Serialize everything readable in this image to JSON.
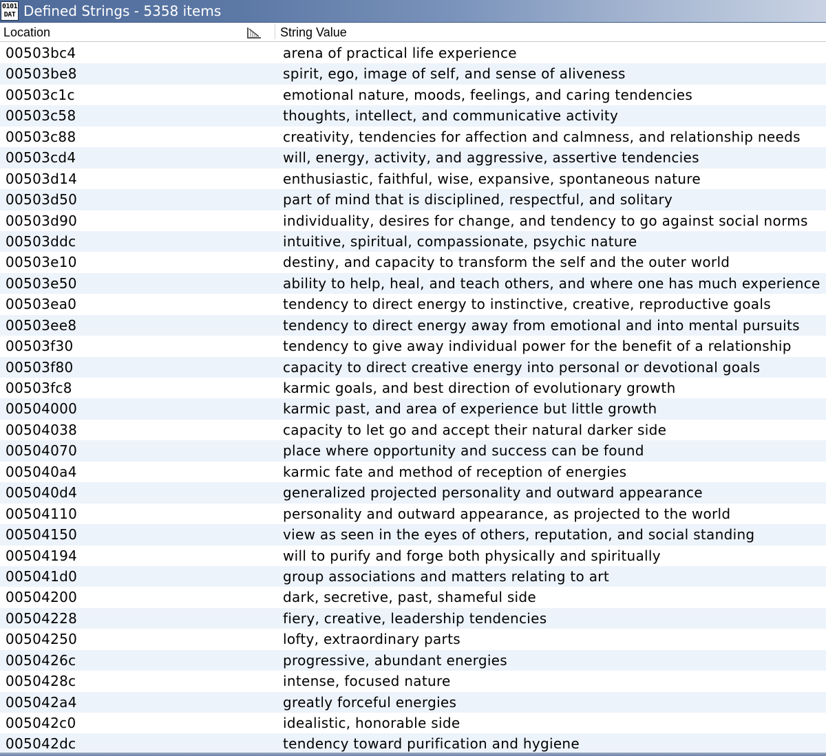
{
  "window": {
    "title": "Defined Strings - 5358 items",
    "icon_line1": "0101",
    "icon_line2": "DAT",
    "icon_name": "data-type-icon"
  },
  "table": {
    "columns": [
      {
        "label": "Location"
      },
      {
        "label": "String Value"
      }
    ],
    "sort_icon": "sort-column-icon",
    "rows": [
      {
        "location": "00503bc4",
        "value": "arena of practical life experience"
      },
      {
        "location": "00503be8",
        "value": "spirit, ego, image of self, and sense of aliveness"
      },
      {
        "location": "00503c1c",
        "value": "emotional nature, moods, feelings, and caring tendencies"
      },
      {
        "location": "00503c58",
        "value": "thoughts, intellect, and communicative activity"
      },
      {
        "location": "00503c88",
        "value": "creativity, tendencies for affection and calmness, and relationship needs"
      },
      {
        "location": "00503cd4",
        "value": "will, energy, activity, and aggressive, assertive tendencies"
      },
      {
        "location": "00503d14",
        "value": "enthusiastic, faithful, wise, expansive, spontaneous nature"
      },
      {
        "location": "00503d50",
        "value": "part of mind that is disciplined, respectful, and solitary"
      },
      {
        "location": "00503d90",
        "value": "individuality, desires for change, and tendency to go against social norms"
      },
      {
        "location": "00503ddc",
        "value": "intuitive, spiritual, compassionate, psychic nature"
      },
      {
        "location": "00503e10",
        "value": "destiny, and capacity to transform the self and the outer world"
      },
      {
        "location": "00503e50",
        "value": "ability to help, heal, and teach others, and where one has much experience"
      },
      {
        "location": "00503ea0",
        "value": "tendency to direct energy to instinctive, creative, reproductive goals"
      },
      {
        "location": "00503ee8",
        "value": "tendency to direct energy away from emotional and into mental pursuits"
      },
      {
        "location": "00503f30",
        "value": "tendency to give away individual power for the benefit of a relationship"
      },
      {
        "location": "00503f80",
        "value": "capacity to direct creative energy into personal or devotional goals"
      },
      {
        "location": "00503fc8",
        "value": "karmic goals, and best direction of evolutionary growth"
      },
      {
        "location": "00504000",
        "value": "karmic past, and area of experience but little growth"
      },
      {
        "location": "00504038",
        "value": "capacity to let go and accept their natural darker side"
      },
      {
        "location": "00504070",
        "value": "place where opportunity and success can be found"
      },
      {
        "location": "005040a4",
        "value": "karmic fate and method of reception of energies"
      },
      {
        "location": "005040d4",
        "value": "generalized projected personality and outward appearance"
      },
      {
        "location": "00504110",
        "value": "personality and outward appearance, as projected to the world"
      },
      {
        "location": "00504150",
        "value": "view as seen in the eyes of others, reputation, and social standing"
      },
      {
        "location": "00504194",
        "value": "will to purify and forge both physically and spiritually"
      },
      {
        "location": "005041d0",
        "value": "group associations and matters relating to art"
      },
      {
        "location": "00504200",
        "value": "dark, secretive, past, shameful side"
      },
      {
        "location": "00504228",
        "value": "fiery, creative, leadership tendencies"
      },
      {
        "location": "00504250",
        "value": "lofty, extraordinary parts"
      },
      {
        "location": "0050426c",
        "value": "progressive, abundant energies"
      },
      {
        "location": "0050428c",
        "value": "intense, focused nature"
      },
      {
        "location": "005042a4",
        "value": "greatly forceful energies"
      },
      {
        "location": "005042c0",
        "value": "idealistic, honorable side"
      },
      {
        "location": "005042dc",
        "value": "tendency toward purification and hygiene"
      }
    ]
  },
  "colors": {
    "title_bar_start": "#4d6a99",
    "title_bar_end": "#c9d3e3",
    "row_alt": "#edf3fa"
  }
}
